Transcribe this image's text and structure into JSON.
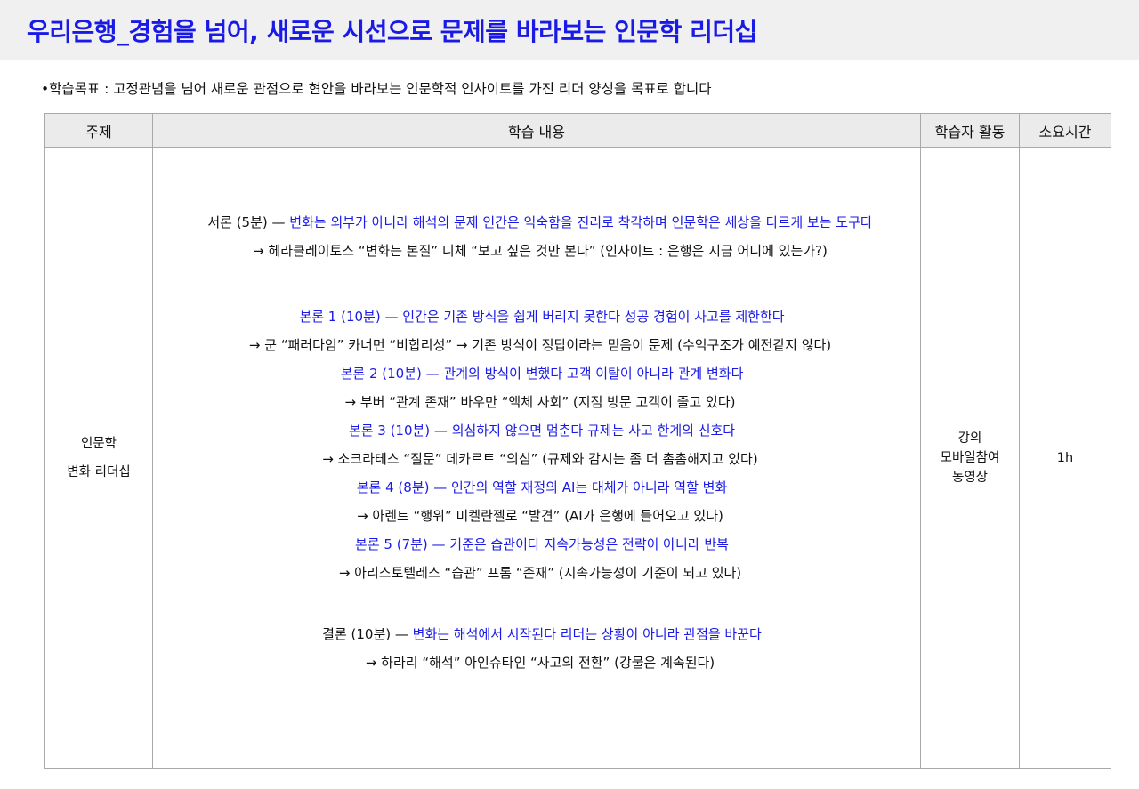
{
  "header": {
    "title": "우리은행_경험을 넘어, 새로운 시선으로 문제를 바라보는 인문학 리더십"
  },
  "goal": "•학습목표 : 고정관념을 넘어 새로운 관점으로 현안을 바라보는 인문학적 인사이트를 가진 리더 양성을 목표로 합니다",
  "table": {
    "columns": [
      "주제",
      "학습 내용",
      "학습자 활동",
      "소요시간"
    ],
    "topic": [
      "인문학",
      "변화 리더십"
    ],
    "activity": [
      "강의",
      "모바일참여",
      "동영상"
    ],
    "duration": "1h",
    "content": {
      "intro": {
        "label": "서론 (5분) — ",
        "text": "변화는 외부가 아니라 해석의 문제 인간은 익숙함을 진리로 착각하며 인문학은 세상을 다르게 보는 도구다",
        "detail": "→ 헤라클레이토스 “변화는 본질” 니체 “보고 싶은 것만 본다” (인사이트 : 은행은 지금 어디에 있는가?)"
      },
      "body": [
        {
          "text": "본론 1 (10분) — 인간은 기존 방식을 쉽게 버리지 못한다 성공 경험이 사고를 제한한다",
          "detail": "→ 쿤 “패러다임” 카너먼 “비합리성” → 기존 방식이 정답이라는 믿음이 문제 (수익구조가 예전같지 않다)"
        },
        {
          "text": "본론 2 (10분) — 관계의 방식이 변했다 고객 이탈이 아니라 관계 변화다",
          "detail": "→ 부버 “관계 존재” 바우만 “액체 사회” (지점 방문 고객이 줄고 있다)"
        },
        {
          "text": "본론 3 (10분) — 의심하지 않으면 멈춘다 규제는 사고 한계의 신호다",
          "detail": "→ 소크라테스 “질문” 데카르트 “의심” (규제와 감시는 좀 더 촘촘해지고 있다)"
        },
        {
          "text": "본론 4 (8분) — 인간의 역할 재정의 AI는 대체가 아니라 역할 변화",
          "detail": "→ 아렌트 “행위” 미켈란젤로 “발견” (AI가 은행에 들어오고 있다)"
        },
        {
          "text": "본론 5 (7분) — 기준은 습관이다 지속가능성은 전략이 아니라 반복",
          "detail": "→ 아리스토텔레스 “습관” 프롬 “존재” (지속가능성이 기준이 되고 있다)"
        }
      ],
      "conclusion": {
        "label": "결론 (10분) — ",
        "text": "변화는 해석에서 시작된다 리더는 상황이 아니라 관점을 바꾼다",
        "detail": "→ 하라리 “해석” 아인슈타인 “사고의 전환” (강물은 계속된다)"
      }
    }
  },
  "colors": {
    "accent": "#1a1ae6",
    "header_bg": "#f0f0f0",
    "table_header_bg": "#ebebeb",
    "border": "#a9a9a9"
  }
}
